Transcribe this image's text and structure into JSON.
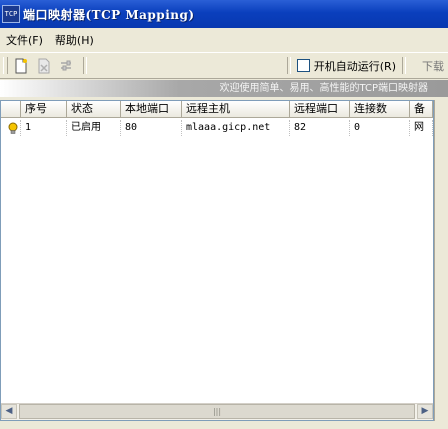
{
  "window": {
    "icon_text": "TCP",
    "title": "端口映射器(TCP Mapping)"
  },
  "menu": [
    {
      "label": "文件(F)"
    },
    {
      "label": "帮助(H)"
    }
  ],
  "toolbar": {
    "autorun_label": "开机自动运行(R)",
    "autorun_checked": false,
    "next_label": "下载"
  },
  "banner": "欢迎使用简单、易用、高性能的TCP端口映射器",
  "table": {
    "columns": [
      "",
      "序号",
      "状态",
      "本地端口",
      "远程主机",
      "远程端口",
      "连接数",
      "备"
    ],
    "rows": [
      {
        "icon": "lightbulb-icon",
        "cells": [
          "1",
          "已启用",
          "80",
          "mlaaa.gicp.net",
          "82",
          "0",
          "网"
        ]
      }
    ]
  },
  "scrollbar": {
    "thumb_grip": "|||"
  },
  "colors": {
    "titlebar": "#0a3fbd",
    "bulb": "#f5c400"
  }
}
